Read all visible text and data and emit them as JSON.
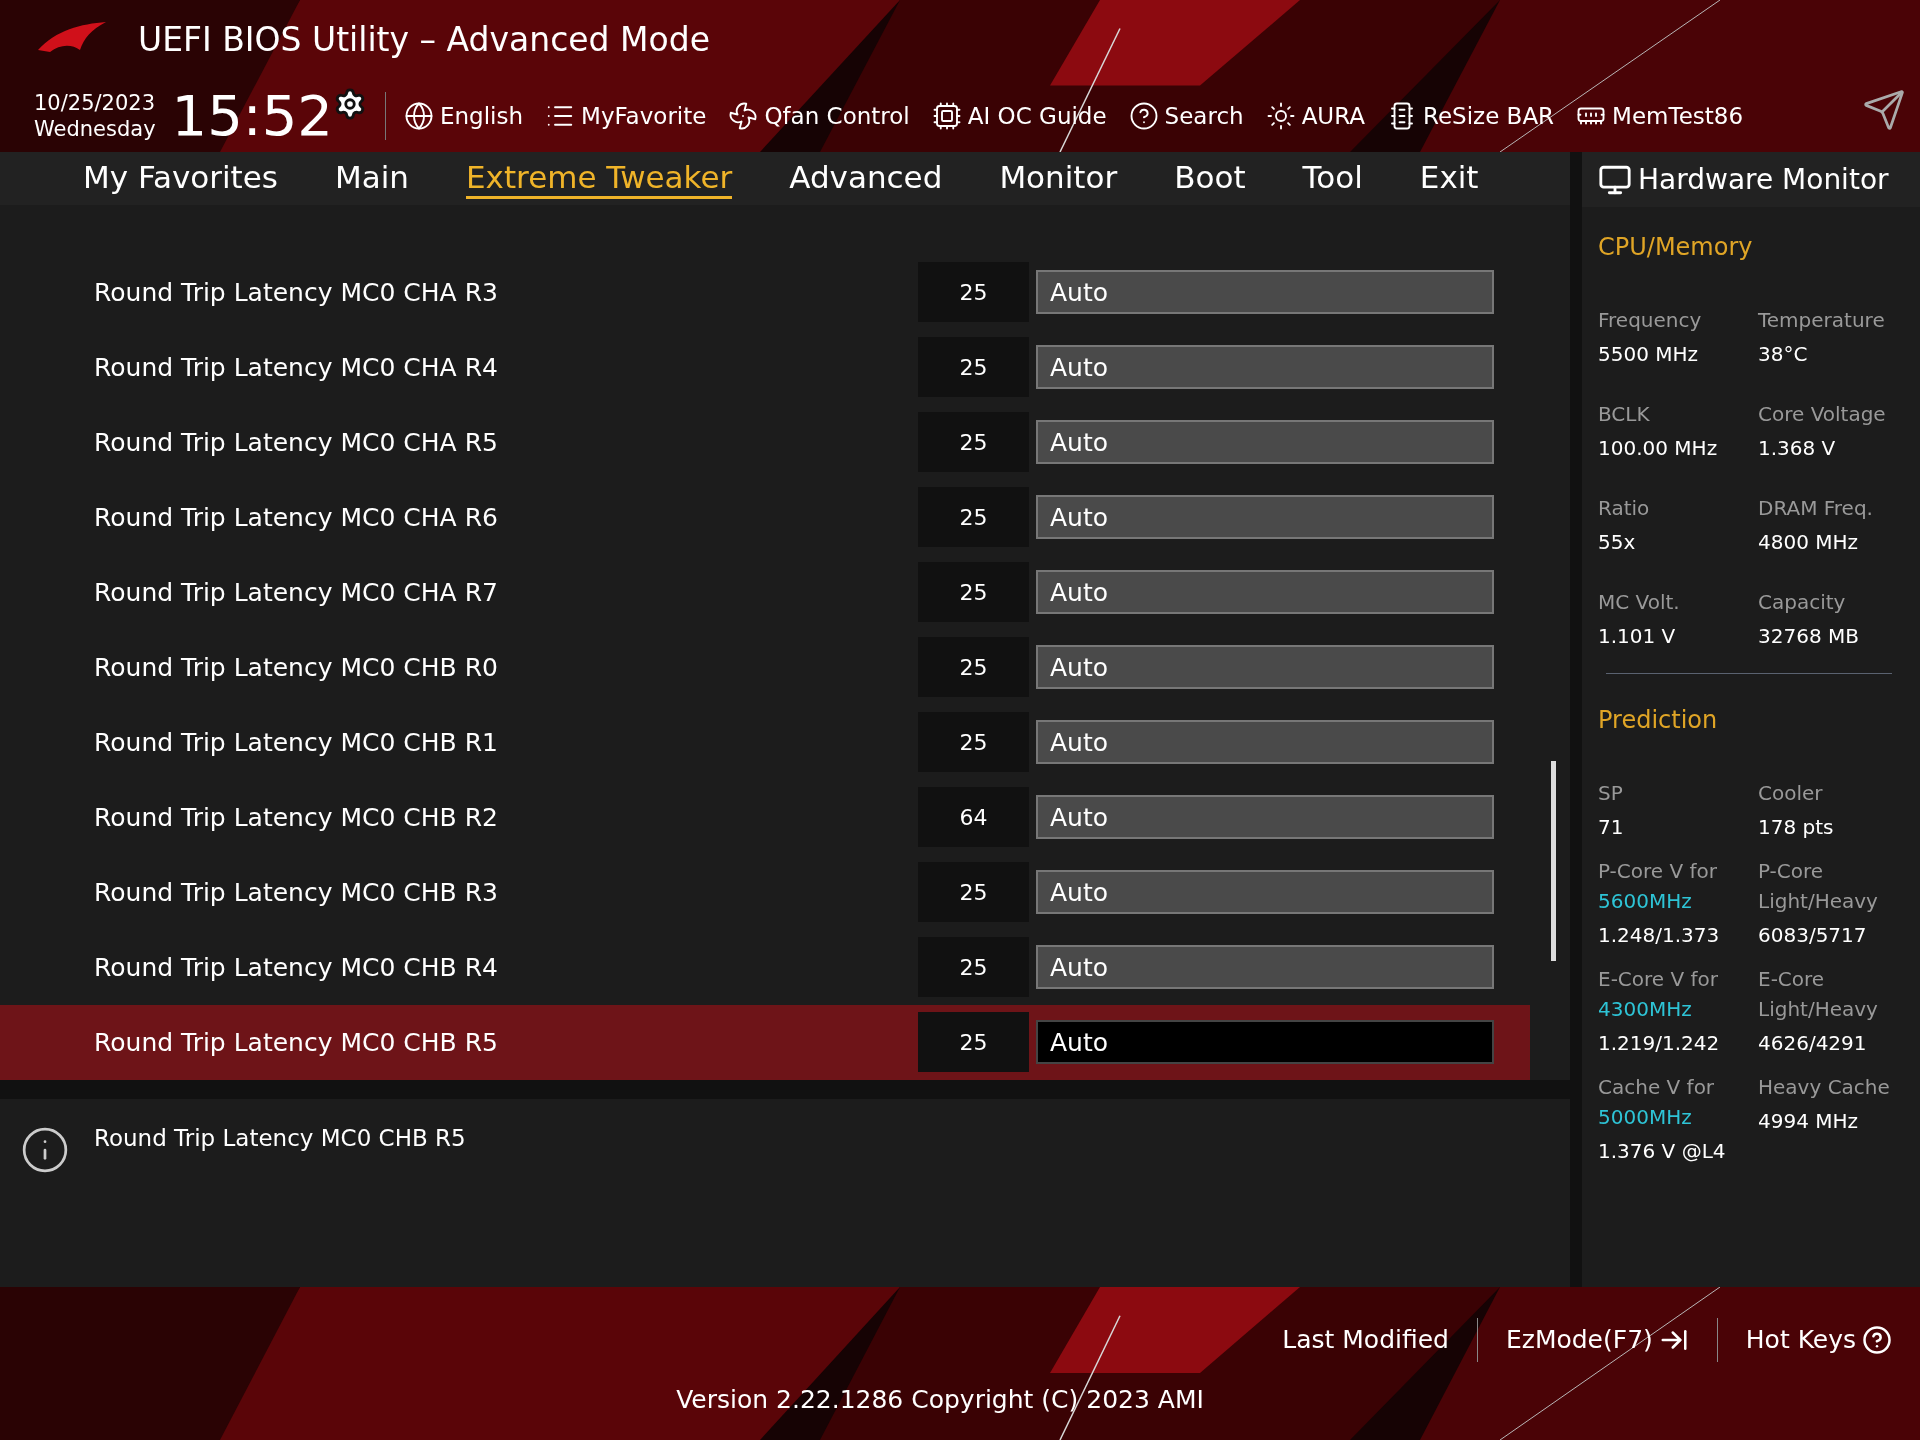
{
  "header": {
    "title": "UEFI BIOS Utility – Advanced Mode",
    "date": "10/25/2023",
    "weekday": "Wednesday",
    "time": "15:52",
    "toolbar": [
      {
        "label": "English"
      },
      {
        "label": "MyFavorite"
      },
      {
        "label": "Qfan Control"
      },
      {
        "label": "AI OC Guide"
      },
      {
        "label": "Search"
      },
      {
        "label": "AURA"
      },
      {
        "label": "ReSize BAR"
      },
      {
        "label": "MemTest86"
      }
    ]
  },
  "tabs": [
    {
      "label": "My Favorites",
      "selected": false
    },
    {
      "label": "Main",
      "selected": false
    },
    {
      "label": "Extreme Tweaker",
      "selected": true
    },
    {
      "label": "Advanced",
      "selected": false
    },
    {
      "label": "Monitor",
      "selected": false
    },
    {
      "label": "Boot",
      "selected": false
    },
    {
      "label": "Tool",
      "selected": false
    },
    {
      "label": "Exit",
      "selected": false
    }
  ],
  "settings": [
    {
      "label": "Round Trip Latency MC0 CHA R3",
      "value": "25",
      "setting": "Auto",
      "selected": false
    },
    {
      "label": "Round Trip Latency MC0 CHA R4",
      "value": "25",
      "setting": "Auto",
      "selected": false
    },
    {
      "label": "Round Trip Latency MC0 CHA R5",
      "value": "25",
      "setting": "Auto",
      "selected": false
    },
    {
      "label": "Round Trip Latency MC0 CHA R6",
      "value": "25",
      "setting": "Auto",
      "selected": false
    },
    {
      "label": "Round Trip Latency MC0 CHA R7",
      "value": "25",
      "setting": "Auto",
      "selected": false
    },
    {
      "label": "Round Trip Latency MC0 CHB R0",
      "value": "25",
      "setting": "Auto",
      "selected": false
    },
    {
      "label": "Round Trip Latency MC0 CHB R1",
      "value": "25",
      "setting": "Auto",
      "selected": false
    },
    {
      "label": "Round Trip Latency MC0 CHB R2",
      "value": "64",
      "setting": "Auto",
      "selected": false
    },
    {
      "label": "Round Trip Latency MC0 CHB R3",
      "value": "25",
      "setting": "Auto",
      "selected": false
    },
    {
      "label": "Round Trip Latency MC0 CHB R4",
      "value": "25",
      "setting": "Auto",
      "selected": false
    },
    {
      "label": "Round Trip Latency MC0 CHB R5",
      "value": "25",
      "setting": "Auto",
      "selected": true
    }
  ],
  "help": {
    "text": "Round Trip Latency MC0 CHB R5"
  },
  "hardware_monitor": {
    "title": "Hardware Monitor",
    "sections": [
      {
        "title": "CPU/Memory",
        "items": [
          {
            "label": "Frequency",
            "value": "5500 MHz"
          },
          {
            "label": "Temperature",
            "value": "38°C"
          },
          {
            "label": "BCLK",
            "value": "100.00 MHz"
          },
          {
            "label": "Core Voltage",
            "value": "1.368 V"
          },
          {
            "label": "Ratio",
            "value": "55x"
          },
          {
            "label": "DRAM Freq.",
            "value": "4800 MHz"
          },
          {
            "label": "MC Volt.",
            "value": "1.101 V"
          },
          {
            "label": "Capacity",
            "value": "32768 MB"
          }
        ]
      },
      {
        "title": "Prediction",
        "items": [
          {
            "label": "SP",
            "value": "71"
          },
          {
            "label": "Cooler",
            "value": "178 pts"
          },
          {
            "label": "P-Core V for",
            "highlight": "5600MHz",
            "value": "1.248/1.373"
          },
          {
            "label": "P-Core Light/Heavy",
            "value": "6083/5717"
          },
          {
            "label": "E-Core V for",
            "highlight": "4300MHz",
            "value": "1.219/1.242"
          },
          {
            "label": "E-Core Light/Heavy",
            "value": "4626/4291"
          },
          {
            "label": "Cache V for",
            "highlight": "5000MHz",
            "value": "1.376 V @L4"
          },
          {
            "label": "Heavy Cache",
            "value": "4994 MHz"
          }
        ]
      }
    ]
  },
  "footer": {
    "buttons": [
      {
        "label": "Last Modified"
      },
      {
        "label": "EzMode(F7)"
      },
      {
        "label": "Hot Keys"
      }
    ],
    "version": "Version 2.22.1286 Copyright (C) 2023 AMI"
  }
}
